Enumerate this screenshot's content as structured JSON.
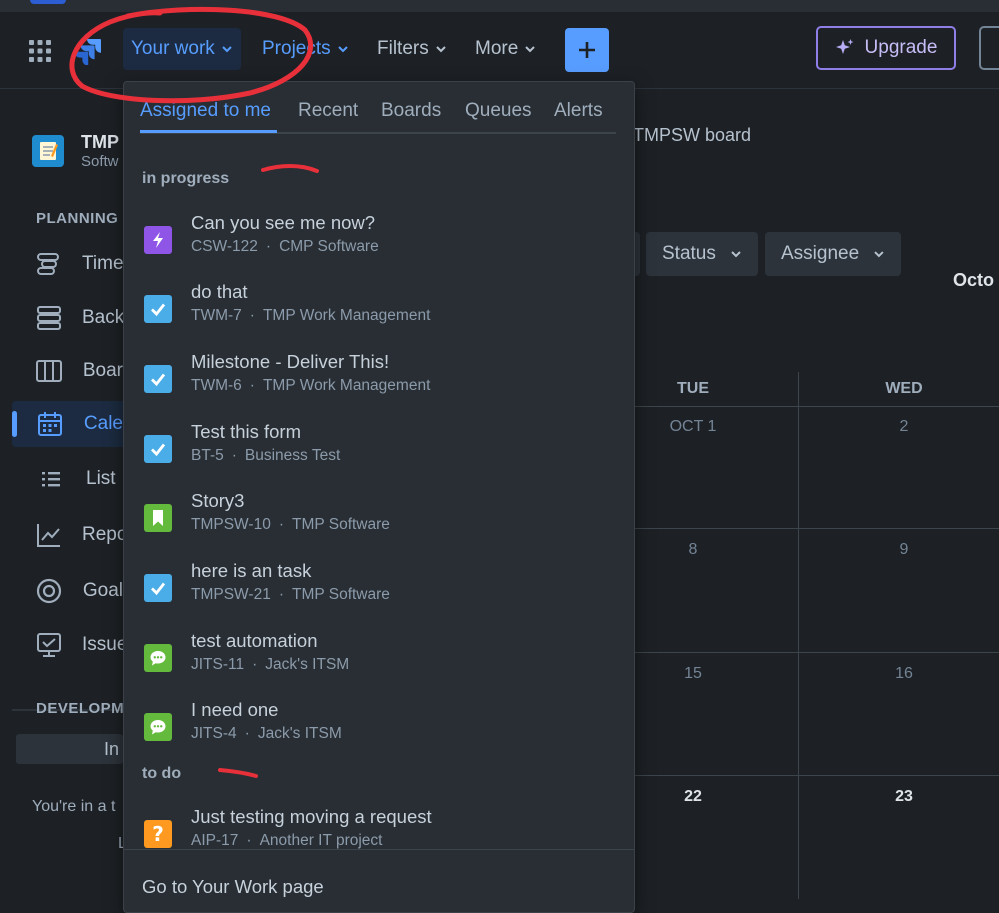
{
  "topnav": {
    "your_work": "Your work",
    "projects": "Projects",
    "filters": "Filters",
    "more": "More",
    "upgrade": "Upgrade"
  },
  "sidebar": {
    "project_name": "TMP",
    "project_type": "Softw",
    "planning_label": "PLANNING",
    "items": [
      {
        "label": "Time",
        "icon": "timeline-icon"
      },
      {
        "label": "Back",
        "icon": "backlog-icon"
      },
      {
        "label": "Boar",
        "icon": "board-icon"
      },
      {
        "label": "Cale",
        "icon": "calendar-icon"
      },
      {
        "label": "List",
        "icon": "list-icon"
      },
      {
        "label": "Repo",
        "icon": "reports-icon"
      },
      {
        "label": "Goal",
        "icon": "goals-icon"
      },
      {
        "label": "Issue",
        "icon": "issues-icon"
      }
    ],
    "development_label": "DEVELOPM",
    "invite": "In",
    "trial_text": "You're in a t",
    "trial_text2": "L"
  },
  "main": {
    "board_title": "TMPSW board",
    "filters": [
      "Status",
      "Assignee"
    ],
    "month": "Octo",
    "day_headers": [
      "TUE",
      "WED"
    ],
    "rows": [
      [
        "OCT 1",
        "2"
      ],
      [
        "8",
        "9"
      ],
      [
        "15",
        "16"
      ],
      [
        "22",
        "23"
      ]
    ]
  },
  "dropdown": {
    "tabs": [
      "Assigned to me",
      "Recent",
      "Boards",
      "Queues",
      "Alerts"
    ],
    "in_progress_label": "in progress",
    "todo_label": "to do",
    "items": [
      {
        "title": "Can you see me now?",
        "key": "CSW-122",
        "project": "CMP Software",
        "icon": "lightning-icon",
        "color": "#8f55e6"
      },
      {
        "title": "do that",
        "key": "TWM-7",
        "project": "TMP Work Management",
        "icon": "checkbox-icon",
        "color": "#4bade8"
      },
      {
        "title": "Milestone - Deliver This!",
        "key": "TWM-6",
        "project": "TMP Work Management",
        "icon": "checkbox-icon",
        "color": "#4bade8"
      },
      {
        "title": "Test this form",
        "key": "BT-5",
        "project": "Business Test",
        "icon": "checkbox-icon",
        "color": "#4bade8"
      },
      {
        "title": "Story3",
        "key": "TMPSW-10",
        "project": "TMP Software",
        "icon": "bookmark-icon",
        "color": "#63ba3c"
      },
      {
        "title": "here is an task",
        "key": "TMPSW-21",
        "project": "TMP Software",
        "icon": "checkbox-icon",
        "color": "#4bade8"
      },
      {
        "title": "test automation",
        "key": "JITS-11",
        "project": "Jack's ITSM",
        "icon": "chat-icon",
        "color": "#63ba3c"
      },
      {
        "title": "I need one",
        "key": "JITS-4",
        "project": "Jack's ITSM",
        "icon": "chat-icon",
        "color": "#63ba3c"
      },
      {
        "title": "Just testing moving a request",
        "key": "AIP-17",
        "project": "Another IT project",
        "icon": "question-icon",
        "color": "#ff991f"
      }
    ],
    "dot": "·",
    "footer_link": "Go to Your Work page"
  }
}
